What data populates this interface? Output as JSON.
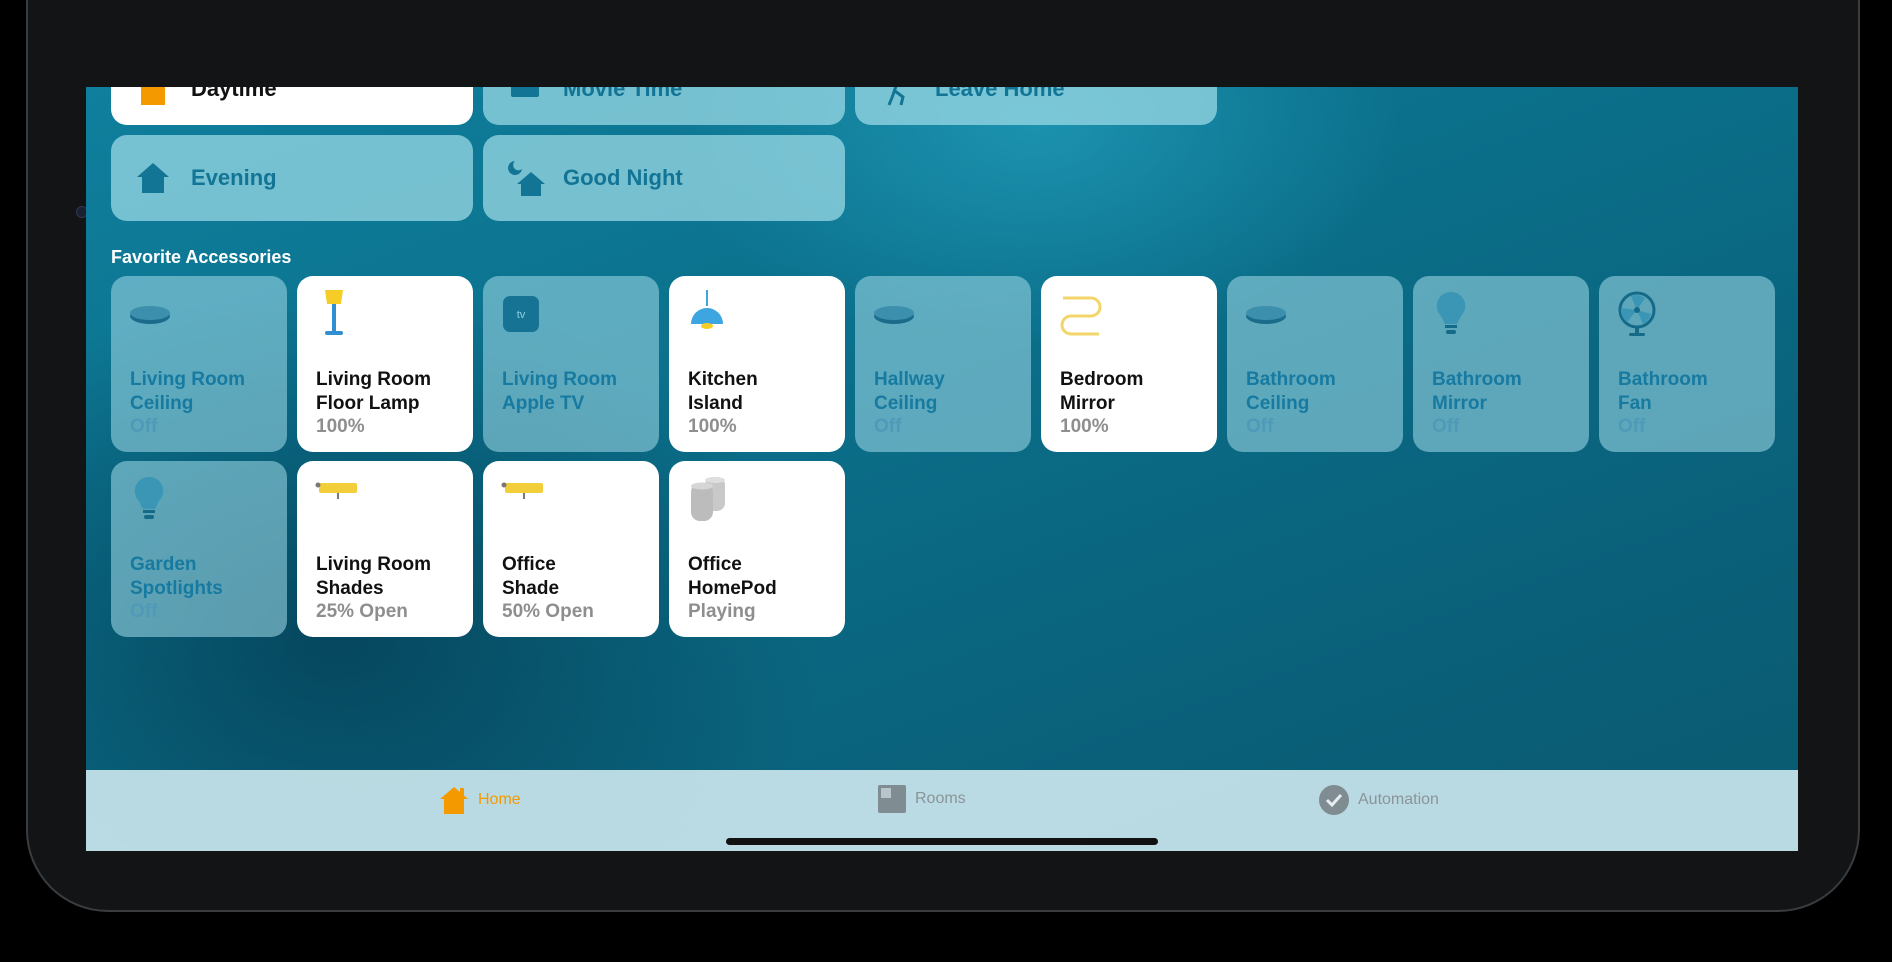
{
  "scenes": [
    {
      "label": "Daytime",
      "icon": "house-sun-icon",
      "active": true
    },
    {
      "label": "Movie Time",
      "icon": "tv-icon",
      "active": false
    },
    {
      "label": "Leave Home",
      "icon": "person-walking-icon",
      "active": false
    },
    {
      "label": "Evening",
      "icon": "house-icon",
      "active": false
    },
    {
      "label": "Good Night",
      "icon": "house-moon-icon",
      "active": false
    }
  ],
  "favorites": {
    "title": "Favorite Accessories",
    "items": [
      {
        "name": "Living Room\nCeiling",
        "status": "Off",
        "icon": "ceiling-light-icon",
        "on": false
      },
      {
        "name": "Living Room\nFloor Lamp",
        "status": "100%",
        "icon": "floor-lamp-icon",
        "on": true
      },
      {
        "name": "Living Room\nApple TV",
        "status": "",
        "icon": "apple-tv-icon",
        "on": false
      },
      {
        "name": "Kitchen\nIsland",
        "status": "100%",
        "icon": "pendant-light-icon",
        "on": true
      },
      {
        "name": "Hallway\nCeiling",
        "status": "Off",
        "icon": "ceiling-light-icon",
        "on": false
      },
      {
        "name": "Bedroom\nMirror",
        "status": "100%",
        "icon": "light-strip-icon",
        "on": true
      },
      {
        "name": "Bathroom\nCeiling",
        "status": "Off",
        "icon": "ceiling-light-icon",
        "on": false
      },
      {
        "name": "Bathroom\nMirror",
        "status": "Off",
        "icon": "light-bulb-icon",
        "on": false
      },
      {
        "name": "Bathroom\nFan",
        "status": "Off",
        "icon": "fan-icon",
        "on": false
      },
      {
        "name": "Garden\nSpotlights",
        "status": "Off",
        "icon": "light-bulb-icon",
        "on": false
      },
      {
        "name": "Living Room\nShades",
        "status": "25% Open",
        "icon": "window-shade-icon",
        "on": true
      },
      {
        "name": "Office\nShade",
        "status": "50% Open",
        "icon": "window-shade-icon",
        "on": true
      },
      {
        "name": "Office\nHomePod",
        "status": "Playing",
        "icon": "homepod-icon",
        "on": true
      }
    ]
  },
  "tabs": [
    {
      "label": "Home",
      "icon": "home-icon",
      "active": true
    },
    {
      "label": "Rooms",
      "icon": "rooms-icon",
      "active": false
    },
    {
      "label": "Automation",
      "icon": "automation-icon",
      "active": false
    }
  ],
  "colors": {
    "accent": "#f49a00",
    "tile_text_off": "#177aa0"
  }
}
